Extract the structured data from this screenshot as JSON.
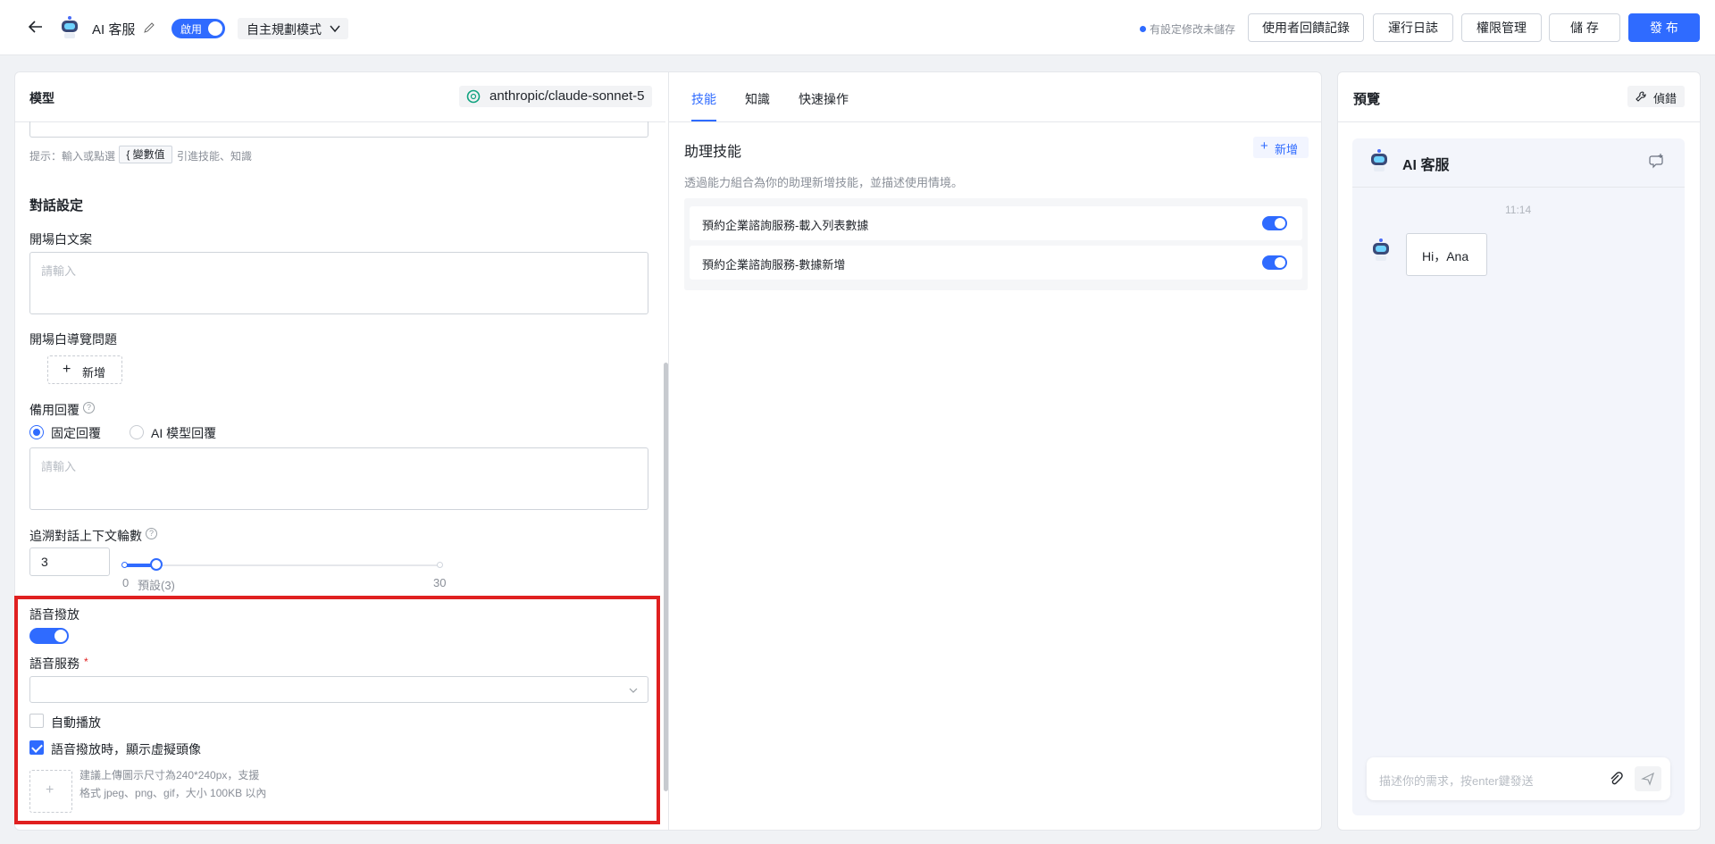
{
  "header": {
    "app_name": "AI 客服",
    "enable_label": "啟用",
    "mode_label": "自主規劃模式",
    "unsaved_notice": "有設定修改未儲存",
    "buttons": {
      "feedback": "使用者回饋記錄",
      "logs": "運行日誌",
      "permissions": "權限管理",
      "save": "儲 存",
      "publish": "發 布"
    }
  },
  "left": {
    "model_label": "模型",
    "model_value": "anthropic/claude-sonnet-5",
    "hint_prefix": "提示：輸入或點選",
    "hint_chip": "{ 變數值",
    "hint_suffix": "引進技能、知識",
    "dialog_section": "對話設定",
    "opening_label": "開場白文案",
    "opening_placeholder": "請輸入",
    "guide_label": "開場白導覽問題",
    "guide_add": "新增",
    "fallback_label": "備用回覆",
    "fallback_option_fixed": "固定回覆",
    "fallback_option_ai": "AI 模型回覆",
    "fallback_placeholder": "請輸入",
    "context_label": "追溯對話上下文輪數",
    "context_value": "3",
    "slider": {
      "min": "0",
      "max": "30",
      "default_label": "預設(3)",
      "value": 3,
      "max_value": 30
    },
    "voice_label": "語音撥放",
    "voice_service_label": "語音服務",
    "required_mark": "*",
    "autoplay_label": "自動播放",
    "avatar_label": "語音撥放時，顯示虛擬頭像",
    "upload_hint": "建議上傳圖示尺寸為240*240px，支援格式 jpeg、png、gif，大小 100KB 以內"
  },
  "middle": {
    "tabs": [
      "技能",
      "知識",
      "快速操作"
    ],
    "skills_title": "助理技能",
    "add_label": "新增",
    "skills_desc": "透過能力組合為你的助理新增技能，並描述使用情境。",
    "skills": [
      "預約企業諮詢服務-載入列表數據",
      "預約企業諮詢服務-數據新增"
    ]
  },
  "right": {
    "title": "預覽",
    "debug_label": "偵錯",
    "bot_name": "AI 客服",
    "time": "11:14",
    "greeting": "Hi，Ana",
    "input_placeholder": "描述你的需求，按enter鍵發送"
  },
  "colors": {
    "primary": "#2f6bff",
    "highlight": "#e02020"
  }
}
